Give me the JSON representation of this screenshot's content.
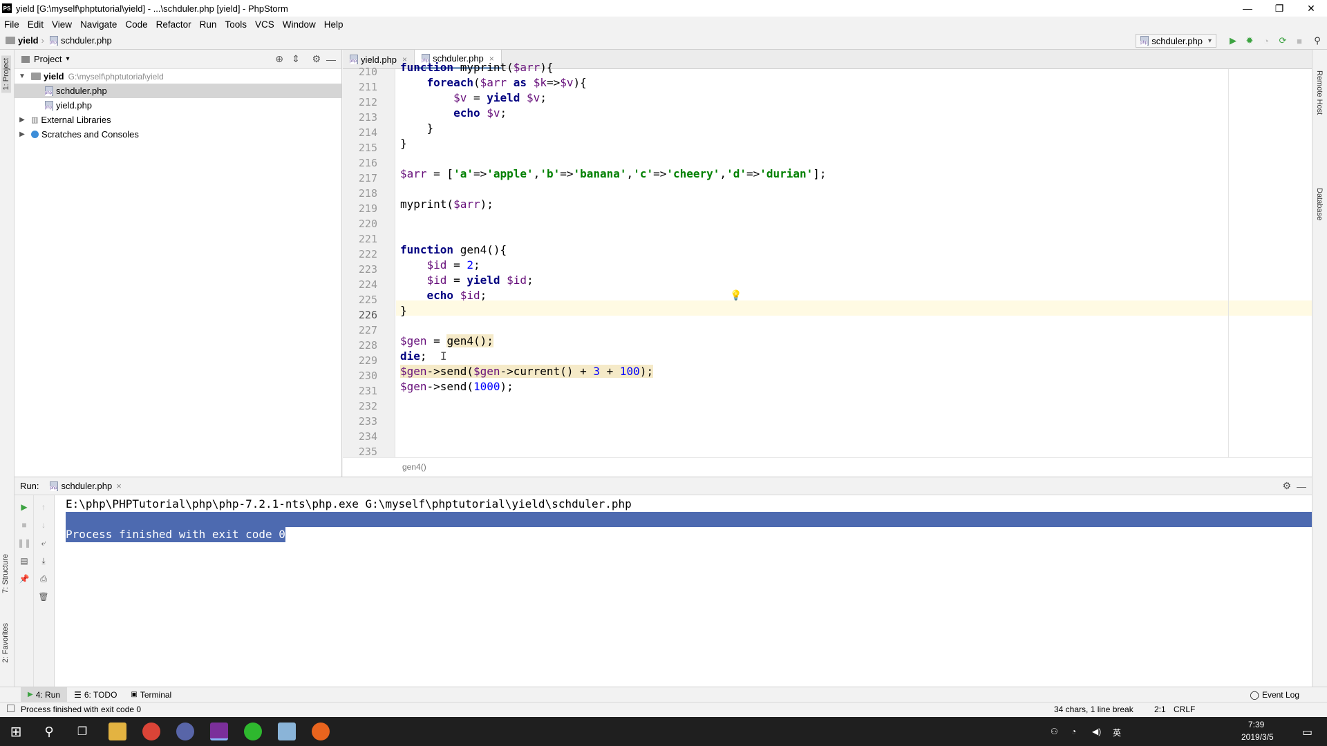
{
  "window": {
    "title": "yield [G:\\myself\\phptutorial\\yield] - ...\\schduler.php [yield] - PhpStorm",
    "logo_text": "PS",
    "minimize": "—",
    "maximize": "❐",
    "close": "✕"
  },
  "menu": [
    "File",
    "Edit",
    "View",
    "Navigate",
    "Code",
    "Refactor",
    "Run",
    "Tools",
    "VCS",
    "Window",
    "Help"
  ],
  "navbar": {
    "project": "yield",
    "file": "schduler.php",
    "run_config": "schduler.php"
  },
  "left_strip": {
    "project_tab": "1: Project",
    "structure_tab": "7: Structure",
    "favorites_tab": "2: Favorites"
  },
  "right_strip": {
    "remote_host": "Remote Host",
    "database": "Database"
  },
  "project_panel": {
    "header": "Project",
    "root": "yield",
    "root_path": "G:\\myself\\phptutorial\\yield",
    "files": [
      "schduler.php",
      "yield.php"
    ],
    "external_libraries": "External Libraries",
    "scratches": "Scratches and Consoles"
  },
  "editor": {
    "tabs": [
      {
        "label": "yield.php",
        "active": false
      },
      {
        "label": "schduler.php",
        "active": true
      }
    ],
    "line_numbers": [
      "210",
      "211",
      "212",
      "213",
      "214",
      "215",
      "216",
      "217",
      "218",
      "219",
      "220",
      "221",
      "222",
      "223",
      "224",
      "225",
      "226",
      "227",
      "228",
      "229",
      "230",
      "231",
      "232",
      "233",
      "234",
      "235"
    ],
    "breadcrumb": "gen4()",
    "current_line": "226"
  },
  "run_panel": {
    "label": "Run:",
    "tab": "schduler.php",
    "command": "E:\\php\\PHPTutorial\\php\\php-7.2.1-nts\\php.exe G:\\myself\\phptutorial\\yield\\schduler.php",
    "result": "Process finished with exit code 0"
  },
  "bottom_tabs": [
    {
      "label": "4: Run",
      "active": true
    },
    {
      "label": "6: TODO",
      "active": false
    },
    {
      "label": "Terminal",
      "active": false
    }
  ],
  "event_log": "Event Log",
  "status": {
    "message": "Process finished with exit code 0",
    "selection": "34 chars, 1 line break",
    "position": "2:1",
    "line_sep": "CRLF"
  },
  "taskbar": {
    "time": "7:39",
    "date": "2019/3/5",
    "ime": "英"
  },
  "colors": {
    "keyword": "#000080",
    "variable": "#660e7a",
    "string": "#008000",
    "number": "#0000ff",
    "selection": "#4d6ab0"
  }
}
